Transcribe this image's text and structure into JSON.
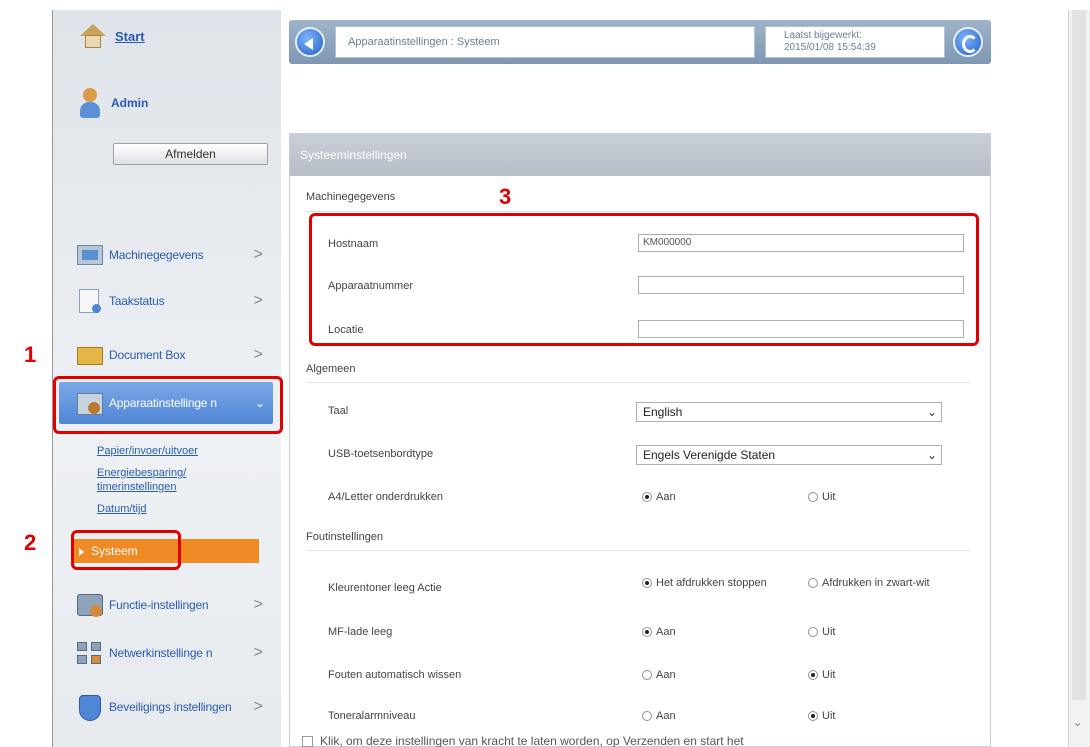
{
  "sidebar": {
    "home_label": "Start",
    "user_label": "Admin",
    "logout_label": "Afmelden",
    "nav": [
      {
        "label": "Machinegegevens",
        "icon": "machine-info-icon"
      },
      {
        "label": "Taakstatus",
        "icon": "job-status-icon"
      },
      {
        "label": "Document Box",
        "icon": "document-box-icon"
      },
      {
        "label": "Apparaatinstellinge n",
        "icon": "device-settings-icon"
      },
      {
        "label": "Functie-instellingen",
        "icon": "function-settings-icon"
      },
      {
        "label": "Netwerkinstellinge n",
        "icon": "network-settings-icon"
      },
      {
        "label": "Beveiligings instellingen",
        "icon": "security-settings-icon"
      }
    ],
    "subnav": [
      "Papier/invoer/uitvoer",
      "Energiebesparing/",
      "timerinstellingen",
      "Datum/tijd"
    ],
    "system_label": "Systeem",
    "chevron": ">"
  },
  "header": {
    "breadcrumb": "Apparaatinstellingen : Systeem",
    "updated_label": "Laatst bijgewerkt:",
    "updated_value": "2015/01/08 15:54:39"
  },
  "panel": {
    "title": "Systeeminstellingen",
    "sections": {
      "machine": "Machinegegevens",
      "general": "Algemeen",
      "errors": "Foutinstellingen"
    },
    "fields": {
      "hostname_label": "Hostnaam",
      "hostname_value": "KM000000",
      "asset_label": "Apparaatnummer",
      "asset_value": "",
      "location_label": "Locatie",
      "location_value": ""
    },
    "general": {
      "language_label": "Taal",
      "language_value": "English",
      "usb_label": "USB-toetsenbordtype",
      "usb_value": "Engels Verenigde Staten",
      "a4_label": "A4/Letter onderdrukken"
    },
    "errors": {
      "color_toner_label": "Kleurentoner leeg Actie",
      "color_opt1": "Het afdrukken stoppen",
      "color_opt2": "Afdrukken in zwart-wit",
      "mp_tray_label": "MF-lade leeg",
      "auto_clear_label": "Fouten automatisch wissen",
      "toner_alarm_label": "Toneralarmniveau"
    },
    "on_label": "Aan",
    "off_label": "Uit",
    "bottom_note": "Klik, om deze instellingen van kracht te laten worden, op Verzenden en start het"
  },
  "callouts": [
    "1",
    "2",
    "3"
  ],
  "colors": {
    "callout": "#e00000",
    "active_nav": "#4f86d6",
    "system_item": "#f08a24"
  }
}
